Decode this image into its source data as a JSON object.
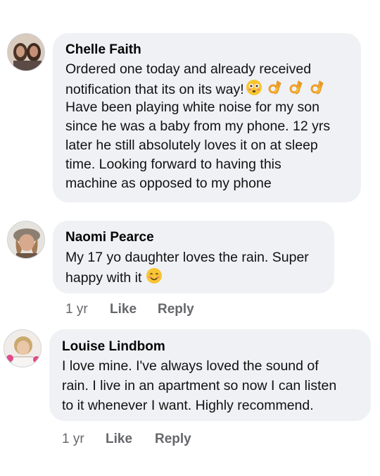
{
  "comments": [
    {
      "author": "Chelle Faith",
      "lines": [
        "Ordered one today and already received",
        "notification that its on its way!",
        "Have been playing white noise for my son",
        "since he was a baby from my phone. 12 yrs",
        "later he still absolutely loves it on at sleep",
        "time. Looking forward to having this",
        "machine as opposed to my phone"
      ],
      "emojis": [
        "flushed-face",
        "ok-hand",
        "ok-hand",
        "ok-hand"
      ]
    },
    {
      "author": "Naomi Pearce",
      "lines": [
        "My 17 yo daughter loves the rain. Super",
        "happy with it"
      ],
      "emojis": [
        "smiling-face"
      ],
      "time": "1 yr",
      "like": "Like",
      "reply": "Reply"
    },
    {
      "author": "Louise Lindbom",
      "lines": [
        "I love mine. I've always loved the sound of",
        "rain. I live in an apartment so now I can listen",
        "to it whenever I want. Highly recommend."
      ],
      "time": "1 yr",
      "like": "Like",
      "reply": "Reply"
    }
  ],
  "colors": {
    "bubble": "#eff1f4",
    "meta": "#65676b",
    "emoji_yellow": "#f7c531"
  }
}
